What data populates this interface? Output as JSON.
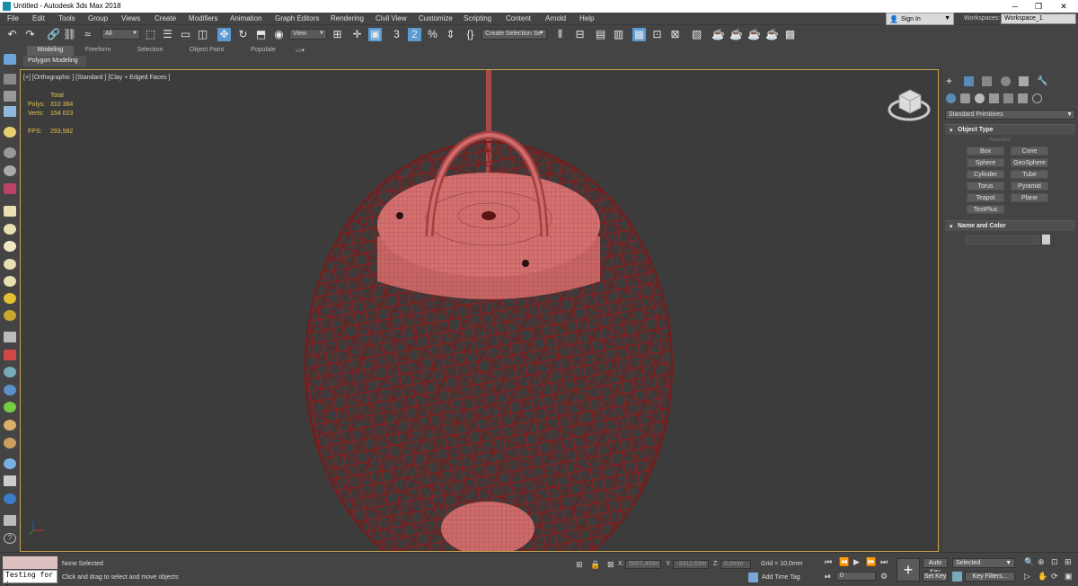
{
  "window": {
    "title": "Untitled - Autodesk 3ds Max 2018",
    "minimize": "─",
    "restore": "❐",
    "close": "✕"
  },
  "menu": [
    "File",
    "Edit",
    "Tools",
    "Group",
    "Views",
    "Create",
    "Modifiers",
    "Animation",
    "Graph Editors",
    "Rendering",
    "Civil View",
    "Customize",
    "Scripting",
    "Content",
    "Arnold",
    "Help"
  ],
  "account": {
    "signin": "Sign In",
    "workspaces_label": "Workspaces:",
    "workspace": "Workspace_1"
  },
  "toolbar": {
    "selection_filter": "All",
    "ref_coord": "View",
    "named_selection": "Create Selection Se",
    "snap_value": "3",
    "angle_snap_value": "2"
  },
  "ribbon": {
    "tabs": [
      "Modeling",
      "Freeform",
      "Selection",
      "Object Paint",
      "Populate"
    ],
    "active": "Modeling",
    "panel": "Polygon Modeling"
  },
  "viewport": {
    "label": "[+] [Orthographic ] [Standard ] [Clay + Edged Faces ]",
    "stats": {
      "total_label": "Total",
      "polys_label": "Polys:",
      "polys": "310 384",
      "verts_label": "Verts:",
      "verts": "154 023",
      "fps_label": "FPS:",
      "fps": "293,582"
    }
  },
  "command_panel": {
    "dropdown": "Standard Primitives",
    "object_type_title": "Object Type",
    "autogrid": "AutoGrid",
    "buttons": [
      "Box",
      "Cone",
      "Sphere",
      "GeoSphere",
      "Cylinder",
      "Tube",
      "Torus",
      "Pyramid",
      "Teapot",
      "Plane",
      "TextPlus"
    ],
    "name_color_title": "Name and Color"
  },
  "status": {
    "maxscript_text": "Testing for :",
    "selection": "None Selected",
    "prompt": "Click and drag to select and move objects",
    "x_label": "X:",
    "x_value": "5007,409n",
    "y_label": "Y:",
    "y_value": "-3312,63m",
    "z_label": "Z:",
    "z_value": "0,0mm",
    "grid": "Grid = 10,0mm",
    "add_time_tag": "Add Time Tag",
    "frame": "0",
    "auto_key": "Auto Key",
    "set_key": "Set Key",
    "selected_dropdown": "Selected",
    "key_filters": "Key Filters..."
  }
}
